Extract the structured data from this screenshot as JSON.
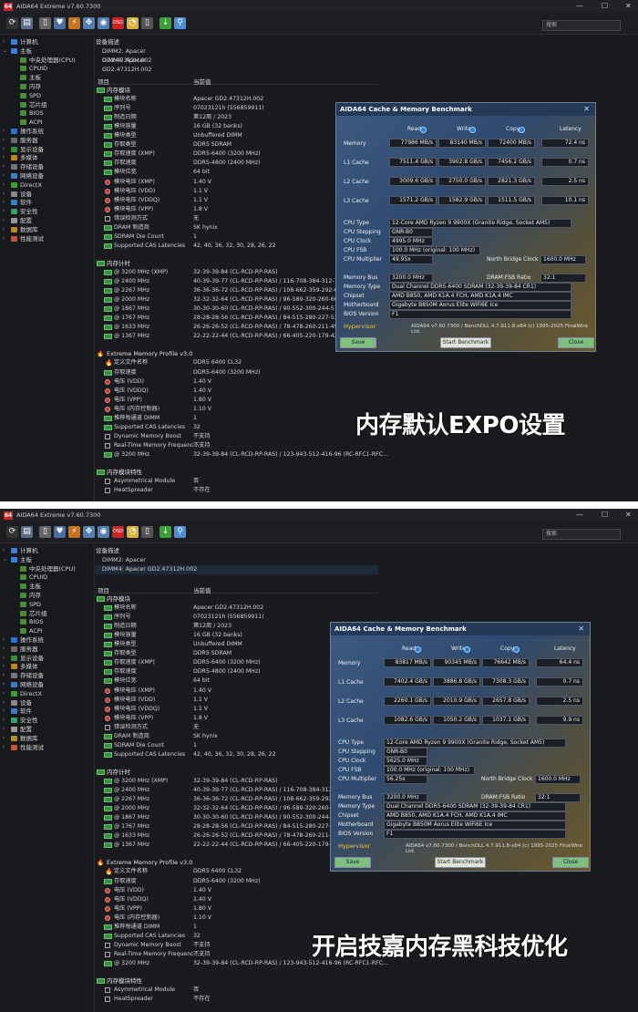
{
  "window": {
    "title": "AIDA64 Extreme v7.60.7300",
    "icon": "64",
    "search_placeholder": "搜索"
  },
  "tree": [
    {
      "label": "计算机",
      "d": 0,
      "arrow": "›",
      "color": "#3d7fd6"
    },
    {
      "label": "主板",
      "d": 0,
      "arrow": "⌄",
      "color": "#3d7fd6"
    },
    {
      "label": "中央处理器(CPU)",
      "d": 1,
      "arrow": "",
      "color": "#4e8a3c"
    },
    {
      "label": "CPUID",
      "d": 1,
      "arrow": "",
      "color": "#4e8a3c"
    },
    {
      "label": "主板",
      "d": 1,
      "arrow": "",
      "color": "#4e8a3c"
    },
    {
      "label": "内存",
      "d": 1,
      "arrow": "",
      "color": "#4e8a3c"
    },
    {
      "label": "SPD",
      "d": 1,
      "arrow": "",
      "color": "#4e8a3c"
    },
    {
      "label": "芯片组",
      "d": 1,
      "arrow": "",
      "color": "#4e8a3c"
    },
    {
      "label": "BIOS",
      "d": 1,
      "arrow": "",
      "color": "#4e8a3c"
    },
    {
      "label": "ACPI",
      "d": 1,
      "arrow": "",
      "color": "#4e8a3c"
    },
    {
      "label": "操作系统",
      "d": 0,
      "arrow": "›",
      "color": "#2f6fcf"
    },
    {
      "label": "服务器",
      "d": 0,
      "arrow": "›",
      "color": "#6a6a6a"
    },
    {
      "label": "显示设备",
      "d": 0,
      "arrow": "›",
      "color": "#3a8f3a"
    },
    {
      "label": "多媒体",
      "d": 0,
      "arrow": "›",
      "color": "#b58a2a"
    },
    {
      "label": "存储设备",
      "d": 0,
      "arrow": "›",
      "color": "#777"
    },
    {
      "label": "网络设备",
      "d": 0,
      "arrow": "›",
      "color": "#3a7fbf"
    },
    {
      "label": "DirectX",
      "d": 0,
      "arrow": "›",
      "color": "#3a9f3a"
    },
    {
      "label": "设备",
      "d": 0,
      "arrow": "›",
      "color": "#888"
    },
    {
      "label": "软件",
      "d": 0,
      "arrow": "›",
      "color": "#3a7fbf"
    },
    {
      "label": "安全性",
      "d": 0,
      "arrow": "›",
      "color": "#3a9f6a"
    },
    {
      "label": "配置",
      "d": 0,
      "arrow": "›",
      "color": "#999"
    },
    {
      "label": "数据库",
      "d": 0,
      "arrow": "›",
      "color": "#b58a2a"
    },
    {
      "label": "性能测试",
      "d": 0,
      "arrow": "›",
      "color": "#c0583a"
    }
  ],
  "device_desc_header": "设备描述",
  "dimms": [
    "DIMM2: Apacer GD2.47312H.002",
    "DIMM4: Apacer GD2.47312H.002"
  ],
  "col_item": "项目",
  "col_value": "当前值",
  "mem_module_title": "内存模块",
  "mem_module": [
    {
      "k": "模块名称",
      "v": "Apacer GD2.47312H.002",
      "i": "sq"
    },
    {
      "k": "序列号",
      "v": "07023121h (556859911)",
      "i": "sq"
    },
    {
      "k": "制造日期",
      "v": "第12周 / 2023",
      "i": "sq"
    },
    {
      "k": "模块容量",
      "v": "16 GB (32 banks)",
      "i": "sq"
    },
    {
      "k": "模块类型",
      "v": "Unbuffered DIMM",
      "i": "sq"
    },
    {
      "k": "存取类型",
      "v": "DDR5 SDRAM",
      "i": "sq"
    },
    {
      "k": "存取速度 (XMP)",
      "v": "DDR5-6400 (3200 MHz)",
      "i": "sq"
    },
    {
      "k": "存取速度",
      "v": "DDR5-4800 (2400 MHz)",
      "i": "sq"
    },
    {
      "k": "模块位宽",
      "v": "64 bit",
      "i": "sq"
    },
    {
      "k": "模块电压 (XMP)",
      "v": "1.40 V",
      "i": "dot"
    },
    {
      "k": "模块电压 (VDD)",
      "v": "1.1 V",
      "i": "dot"
    },
    {
      "k": "模块电压 (VDDQ)",
      "v": "1.1 V",
      "i": "dot"
    },
    {
      "k": "模块电压 (VPP)",
      "v": "1.8 V",
      "i": "dot"
    },
    {
      "k": "错误检测方式",
      "v": "无",
      "i": "cb"
    },
    {
      "k": "DRAM 制造商",
      "v": "SK hynix",
      "i": "sq"
    },
    {
      "k": "SDRAM Die Count",
      "v": "1",
      "i": "sq"
    },
    {
      "k": "Supported CAS Latencies",
      "v": "42, 40, 36, 32, 30, 28, 26, 22",
      "i": "sq"
    }
  ],
  "timing_title": "内存计时",
  "timings": [
    {
      "k": "@ 3200 MHz (XMP)",
      "v": "32-39-39-84  (CL-RCD-RP-RAS)"
    },
    {
      "k": "@ 2400 MHz",
      "v": "40-39-39-77  (CL-RCD-RP-RAS) / 116-708-384-312-72"
    },
    {
      "k": "@ 2267 MHz",
      "v": "36-36-36-72  (CL-RCD-RP-RAS) / 108-662-359-292-68"
    },
    {
      "k": "@ 2000 MHz",
      "v": "32-32-32-64  (CL-RCD-RP-RAS) / 96-589-320-260-60"
    },
    {
      "k": "@ 1867 MHz",
      "v": "30-30-30-60  (CL-RCD-RP-RAS) / 90-552-300-244-57"
    },
    {
      "k": "@ 1767 MHz",
      "v": "28-28-28-56  (CL-RCD-RP-RAS) / 84-515-280-227-53"
    },
    {
      "k": "@ 1633 MHz",
      "v": "26-26-26-52  (CL-RCD-RP-RAS) / 78-478-260-211-49"
    },
    {
      "k": "@ 1367 MHz",
      "v": "22-22-22-44  (CL-RCD-RP-RAS) / 66-405-220-179-42"
    }
  ],
  "xmp_title": "Extreme Memory Profile v3.0",
  "xmp": [
    {
      "k": "定义文件名称",
      "v": "DDR5 6400 CL32",
      "i": "flame"
    },
    {
      "k": "存取速度",
      "v": "DDR5-6400 (3200 MHz)",
      "i": "sq"
    },
    {
      "k": "电压 (VDD)",
      "v": "1.40 V",
      "i": "dot"
    },
    {
      "k": "电压 (VDDQ)",
      "v": "1.40 V",
      "i": "dot"
    },
    {
      "k": "电压 (VPP)",
      "v": "1.80 V",
      "i": "dot"
    },
    {
      "k": "电压 (内存控制器)",
      "v": "1.10 V",
      "i": "dot"
    },
    {
      "k": "推荐每通道 DIMM",
      "v": "1",
      "i": "sq"
    },
    {
      "k": "Supported CAS Latencies",
      "v": "32",
      "i": "sq"
    },
    {
      "k": "Dynamic Memory Boost",
      "v": "不支持",
      "i": "cb"
    },
    {
      "k": "Real-Time Memory Frequenc...",
      "v": "不支持",
      "i": "cb"
    },
    {
      "k": "@ 3200 MHz",
      "v": "32-39-39-84  (CL-RCD-RP-RAS) / 123-943-512-416-96  (RC-RFC1-RFC...",
      "i": "sq"
    }
  ],
  "features_title": "内存模块特性",
  "features": [
    {
      "k": "Asymmetrical Module",
      "v": "否",
      "i": "cb"
    },
    {
      "k": "HeatSpreader",
      "v": "不存在",
      "i": "cb"
    }
  ],
  "bench": {
    "title": "AIDA64 Cache & Memory Benchmark",
    "cols": [
      "Read",
      "Write",
      "Copy",
      "Latency"
    ],
    "rows": [
      "Memory",
      "L1 Cache",
      "L2 Cache",
      "L3 Cache"
    ],
    "info_labels": [
      "CPU Type",
      "CPU Stepping",
      "CPU Clock",
      "CPU FSB",
      "CPU Multiplier"
    ],
    "nb_label": "North Bridge Clock",
    "mb_labels": [
      "Memory Bus",
      "Memory Type",
      "Chipset",
      "Motherboard",
      "BIOS Version"
    ],
    "ratio_label": "DRAM:FSB Ratio",
    "hypervisor": "Hypervisor",
    "version": "AIDA64 v7.60.7300 / BenchDLL 4.7.911.8-x64  (c) 1995-2025 FinalWire Ltd.",
    "btn_save": "Save",
    "btn_start": "Start Benchmark",
    "btn_close": "Close",
    "shared": {
      "cpu_type": "12-Core AMD Ryzen 9 9900X  (Granite Ridge, Socket AM5)",
      "cpu_stepping": "GNR-B0",
      "cpu_fsb": "100.0 MHz  (original: 100 MHz)",
      "mem_type": "Dual Channel DDR5-6400 SDRAM  (32-39-39-84 CR1)",
      "chipset": "AMD B850, AMD K1A.4 FCH, AMD K1A.4 IMC",
      "motherboard": "Gigabyte B850M Aorus Elite WiFi6E Ice",
      "bios": "F1",
      "ratio": "32:1",
      "nb": "1600.0 MHz",
      "membus": "3200.0 MHz"
    }
  },
  "panel1": {
    "values": [
      [
        "77986 MB/s",
        "83140 MB/s",
        "72400 MB/s",
        "72.4 ns"
      ],
      [
        "7511.4 GB/s",
        "3902.8 GB/s",
        "7456.2 GB/s",
        "0.7 ns"
      ],
      [
        "3009.6 GB/s",
        "2750.0 GB/s",
        "2821.3 GB/s",
        "2.5 ns"
      ],
      [
        "1571.2 GB/s",
        "1582.9 GB/s",
        "1511.5 GB/s",
        "10.1 ns"
      ]
    ],
    "cpu_clock": "4995.0 MHz",
    "cpu_mult": "49.95x",
    "caption": "内存默认EXPO设置"
  },
  "panel2": {
    "values": [
      [
        "83817 MB/s",
        "90345 MB/s",
        "76642 MB/s",
        "64.4 ns"
      ],
      [
        "7402.4 GB/s",
        "3886.8 GB/s",
        "7308.3 GB/s",
        "0.7 ns"
      ],
      [
        "2260.1 GB/s",
        "2010.9 GB/s",
        "2657.8 GB/s",
        "2.5 ns"
      ],
      [
        "1082.6 GB/s",
        "1050.2 GB/s",
        "1037.1 GB/s",
        "9.9 ns"
      ]
    ],
    "cpu_clock": "5625.0 MHz",
    "cpu_mult": "56.25x",
    "caption": "开启技嘉内存黑科技优化"
  }
}
